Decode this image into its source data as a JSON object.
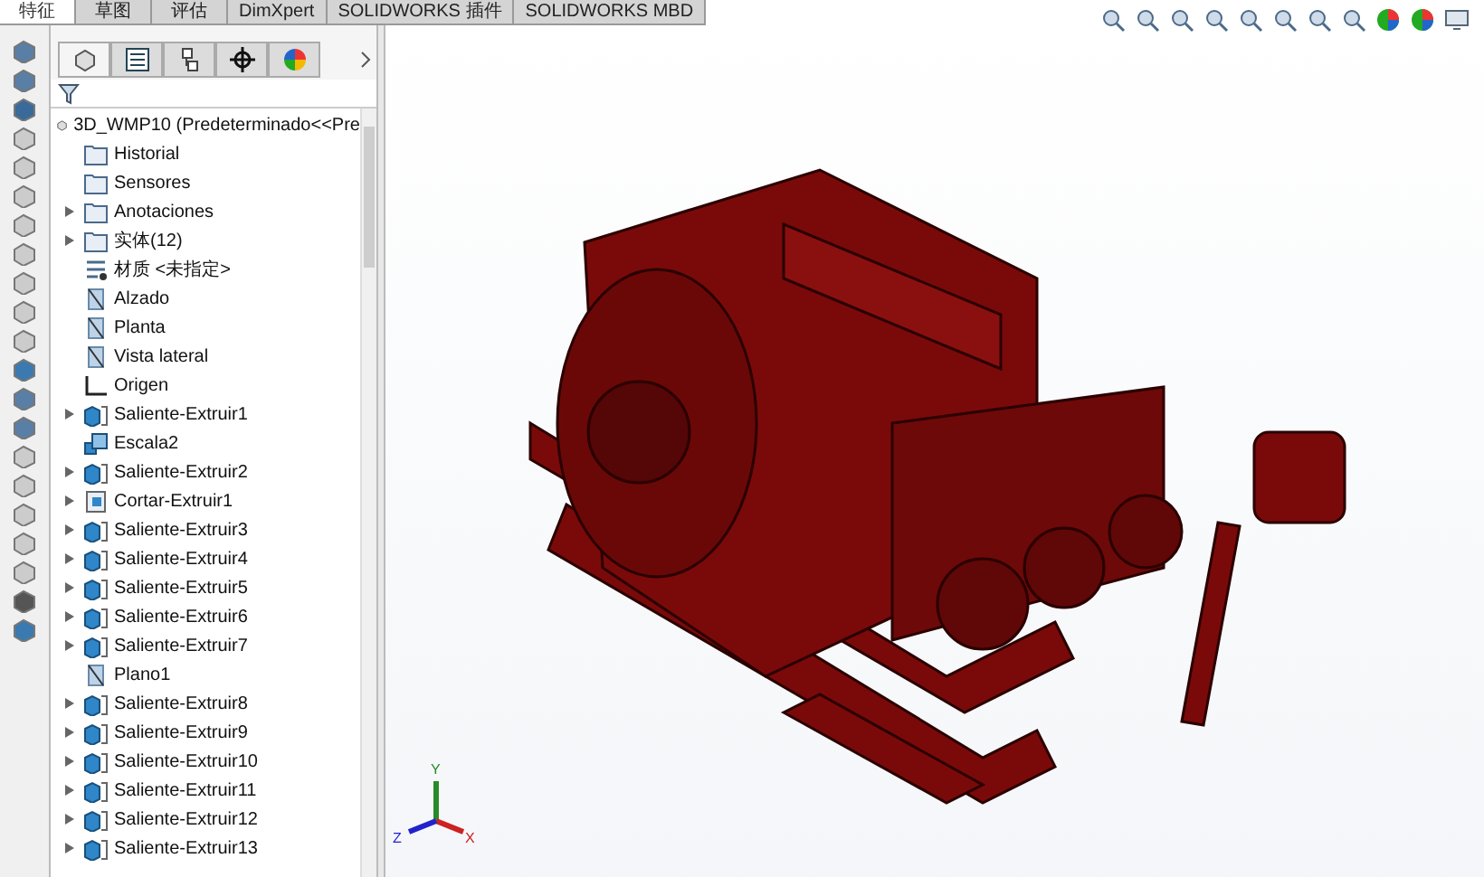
{
  "tabs": [
    {
      "label": "特征",
      "selected": true
    },
    {
      "label": "草图",
      "selected": false
    },
    {
      "label": "评估",
      "selected": false
    },
    {
      "label": "DimXpert",
      "selected": false
    },
    {
      "label": "SOLIDWORKS 插件",
      "selected": false
    },
    {
      "label": "SOLIDWORKS MBD",
      "selected": false
    }
  ],
  "panel_tabs": [
    {
      "kind": "feature",
      "selected": true
    },
    {
      "kind": "property",
      "selected": false
    },
    {
      "kind": "config",
      "selected": false
    },
    {
      "kind": "dim",
      "selected": false
    },
    {
      "kind": "display",
      "selected": false
    }
  ],
  "tree": {
    "root": "3D_WMP10  (Predeterminado<<Pre",
    "items": [
      {
        "label": "Historial",
        "kind": "folder",
        "expandable": false
      },
      {
        "label": "Sensores",
        "kind": "folder",
        "expandable": false
      },
      {
        "label": "Anotaciones",
        "kind": "folder",
        "expandable": true
      },
      {
        "label": "实体(12)",
        "kind": "folder",
        "expandable": true
      },
      {
        "label": "材质 <未指定>",
        "kind": "material",
        "expandable": false
      },
      {
        "label": "Alzado",
        "kind": "plane",
        "expandable": false
      },
      {
        "label": "Planta",
        "kind": "plane",
        "expandable": false
      },
      {
        "label": "Vista lateral",
        "kind": "plane",
        "expandable": false
      },
      {
        "label": "Origen",
        "kind": "origin",
        "expandable": false
      },
      {
        "label": "Saliente-Extruir1",
        "kind": "boss",
        "expandable": true
      },
      {
        "label": "Escala2",
        "kind": "scale",
        "expandable": false
      },
      {
        "label": "Saliente-Extruir2",
        "kind": "boss",
        "expandable": true
      },
      {
        "label": "Cortar-Extruir1",
        "kind": "cut",
        "expandable": true
      },
      {
        "label": "Saliente-Extruir3",
        "kind": "boss",
        "expandable": true
      },
      {
        "label": "Saliente-Extruir4",
        "kind": "boss",
        "expandable": true
      },
      {
        "label": "Saliente-Extruir5",
        "kind": "boss",
        "expandable": true
      },
      {
        "label": "Saliente-Extruir6",
        "kind": "boss",
        "expandable": true
      },
      {
        "label": "Saliente-Extruir7",
        "kind": "boss",
        "expandable": true
      },
      {
        "label": "Plano1",
        "kind": "plane",
        "expandable": false
      },
      {
        "label": "Saliente-Extruir8",
        "kind": "boss",
        "expandable": true
      },
      {
        "label": "Saliente-Extruir9",
        "kind": "boss",
        "expandable": true
      },
      {
        "label": "Saliente-Extruir10",
        "kind": "boss",
        "expandable": true
      },
      {
        "label": "Saliente-Extruir11",
        "kind": "boss",
        "expandable": true
      },
      {
        "label": "Saliente-Extruir12",
        "kind": "boss",
        "expandable": true
      },
      {
        "label": "Saliente-Extruir13",
        "kind": "boss",
        "expandable": true
      }
    ]
  },
  "viewport": {
    "axes": {
      "x": "X",
      "y": "Y",
      "z": "Z"
    }
  }
}
